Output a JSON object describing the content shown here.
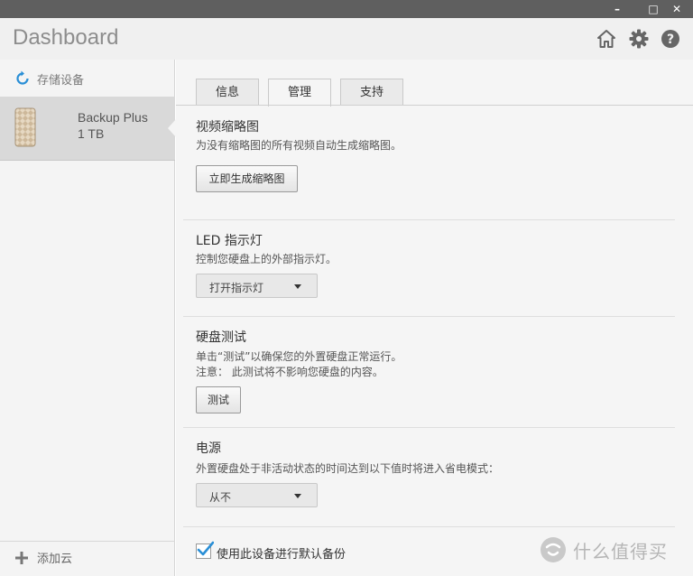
{
  "window": {
    "minimize_glyph": "–",
    "maximize_glyph": "□",
    "close_glyph": "✕"
  },
  "header": {
    "title": "Dashboard",
    "icons": [
      "home-icon",
      "gear-icon",
      "help-icon"
    ]
  },
  "sidebar": {
    "storage_label": "存储设备",
    "device": {
      "name": "Backup Plus",
      "size": "1 TB"
    },
    "add_cloud_label": "添加云"
  },
  "tabs": [
    {
      "label": "信息",
      "active": false
    },
    {
      "label": "管理",
      "active": true
    },
    {
      "label": "支持",
      "active": false
    }
  ],
  "sections": {
    "thumbnails": {
      "title": "视频缩略图",
      "desc": "为没有缩略图的所有视频自动生成缩略图。",
      "button": "立即生成缩略图"
    },
    "led": {
      "title": "LED 指示灯",
      "desc": "控制您硬盘上的外部指示灯。",
      "select_value": "打开指示灯"
    },
    "disk_test": {
      "title": "硬盘测试",
      "desc1": "单击“测试”以确保您的外置硬盘正常运行。",
      "desc2": "注意： 此测试将不影响您硬盘的内容。",
      "button": "测试"
    },
    "power": {
      "title": "电源",
      "desc": "外置硬盘处于非活动状态的时间达到以下值时将进入省电模式：",
      "select_value": "从不"
    },
    "backup": {
      "checkbox_label": "使用此设备进行默认备份",
      "checked": true
    }
  },
  "watermark": {
    "text": "什么值得买"
  },
  "colors": {
    "titlebar": "#5f5f5f",
    "header_bg": "#f0f0f0",
    "sidebar_selected": "#d9d9d9",
    "accent_blue": "#2a8fd6",
    "checkmark": "#2a8fd6"
  }
}
